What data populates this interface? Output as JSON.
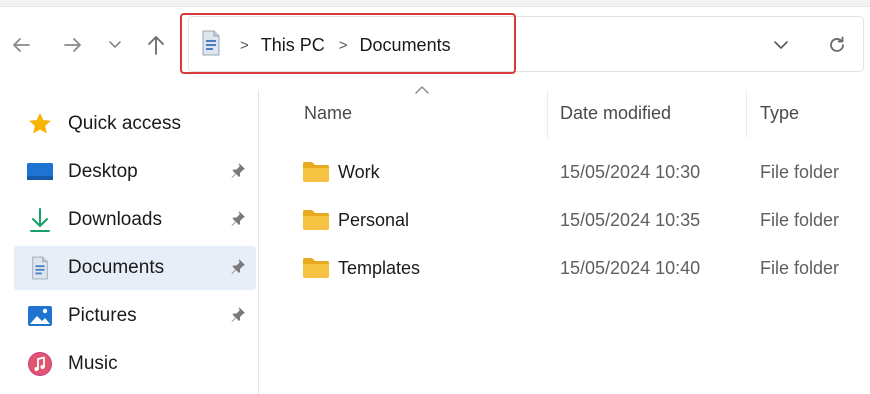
{
  "nav": {
    "back_icon": "arrow-left-icon",
    "forward_icon": "arrow-right-icon",
    "recent_icon": "chevron-down-icon",
    "up_icon": "arrow-up-icon"
  },
  "address_bar": {
    "location_icon": "documents-icon",
    "crumbs": [
      "This PC",
      "Documents"
    ],
    "dropdown_icon": "chevron-down-icon",
    "refresh_icon": "refresh-icon",
    "highlight_color": "#d83a3a"
  },
  "sidebar": {
    "items": [
      {
        "label": "Quick access",
        "icon": "star-icon",
        "pinned": false
      },
      {
        "label": "Desktop",
        "icon": "desktop-icon",
        "pinned": true
      },
      {
        "label": "Downloads",
        "icon": "download-icon",
        "pinned": true
      },
      {
        "label": "Documents",
        "icon": "documents-icon",
        "pinned": true,
        "selected": true
      },
      {
        "label": "Pictures",
        "icon": "pictures-icon",
        "pinned": true
      },
      {
        "label": "Music",
        "icon": "music-icon",
        "pinned": false
      }
    ]
  },
  "file_list": {
    "columns": [
      "Name",
      "Date modified",
      "Type"
    ],
    "sorted_column": "Name",
    "rows": [
      {
        "name": "Work",
        "date": "15/05/2024 10:30",
        "type": "File folder"
      },
      {
        "name": "Personal",
        "date": "15/05/2024 10:35",
        "type": "File folder"
      },
      {
        "name": "Templates",
        "date": "15/05/2024 10:40",
        "type": "File folder"
      }
    ]
  },
  "colors": {
    "folder": "#f5c242",
    "selected_bg": "#e8eef7",
    "accent_blue": "#1a73c9"
  }
}
